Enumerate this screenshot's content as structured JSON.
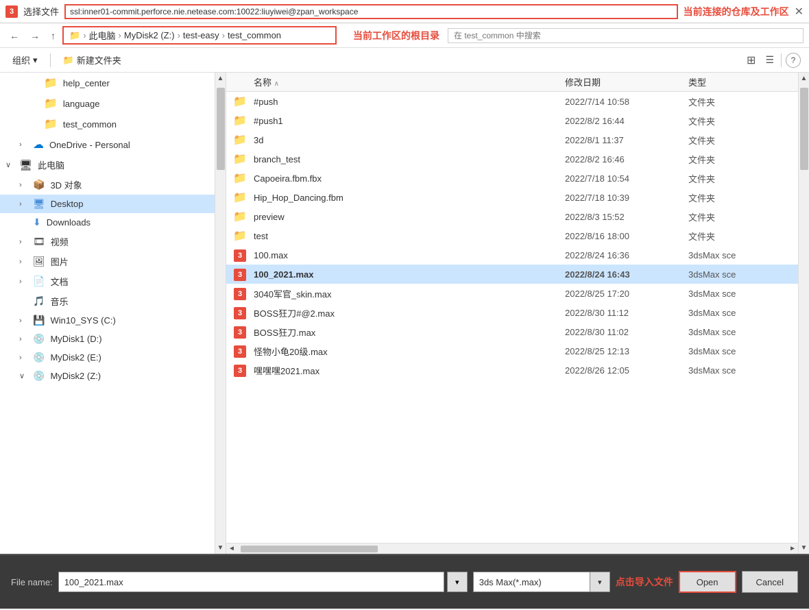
{
  "titlebar": {
    "label": "选择文件",
    "path": "ssl:inner01-commit.perforce.nie.netease.com:10022:liuyiwei@zpan_workspace",
    "annotation": "当前连接的仓库及工作区"
  },
  "navbar": {
    "back": "←",
    "forward": "→",
    "up": "↑",
    "breadcrumb": [
      "此电脑",
      "MyDisk2 (Z:)",
      "test-easy",
      "test_common"
    ],
    "breadcrumb_icon": "📁",
    "annotation": "当前工作区的根目录",
    "search_placeholder": "在 test_common 中搜索"
  },
  "toolbar": {
    "organize": "组织",
    "new_folder": "新建文件夹",
    "view_icons": "⊞",
    "view_list": "☰",
    "help": "?"
  },
  "sidebar": {
    "items": [
      {
        "id": "help_center",
        "label": "help_center",
        "indent": 2,
        "icon": "folder",
        "expand": ""
      },
      {
        "id": "language",
        "label": "language",
        "indent": 2,
        "icon": "folder",
        "expand": ""
      },
      {
        "id": "test_common",
        "label": "test_common",
        "indent": 2,
        "icon": "folder",
        "expand": ""
      },
      {
        "id": "onedrive",
        "label": "OneDrive - Personal",
        "indent": 1,
        "icon": "onedrive",
        "expand": ">"
      },
      {
        "id": "computer",
        "label": "此电脑",
        "indent": 0,
        "icon": "computer",
        "expand": "∨"
      },
      {
        "id": "3d",
        "label": "3D 对象",
        "indent": 1,
        "icon": "folder3d",
        "expand": ">"
      },
      {
        "id": "desktop",
        "label": "Desktop",
        "indent": 1,
        "icon": "desktop",
        "expand": ">"
      },
      {
        "id": "downloads",
        "label": "Downloads",
        "indent": 1,
        "icon": "download",
        "expand": ""
      },
      {
        "id": "videos",
        "label": "视频",
        "indent": 1,
        "icon": "video",
        "expand": ">"
      },
      {
        "id": "pictures",
        "label": "图片",
        "indent": 1,
        "icon": "picture",
        "expand": ">"
      },
      {
        "id": "documents",
        "label": "文档",
        "indent": 1,
        "icon": "document",
        "expand": ">"
      },
      {
        "id": "music",
        "label": "音乐",
        "indent": 1,
        "icon": "music",
        "expand": ""
      },
      {
        "id": "win10sys",
        "label": "Win10_SYS (C:)",
        "indent": 1,
        "icon": "disk",
        "expand": ">"
      },
      {
        "id": "mydisk1",
        "label": "MyDisk1 (D:)",
        "indent": 1,
        "icon": "disk",
        "expand": ">"
      },
      {
        "id": "mydisk2e",
        "label": "MyDisk2 (E:)",
        "indent": 1,
        "icon": "disk",
        "expand": ">"
      },
      {
        "id": "mydisk2z",
        "label": "MyDisk2 (Z:)",
        "indent": 1,
        "icon": "disk",
        "expand": "∨"
      }
    ]
  },
  "filelist": {
    "headers": {
      "name": "名称",
      "date": "修改日期",
      "type": "类型"
    },
    "rows": [
      {
        "id": "push",
        "name": "#push",
        "date": "2022/7/14 10:58",
        "type": "文件夹",
        "icon": "folder",
        "selected": false
      },
      {
        "id": "push1",
        "name": "#push1",
        "date": "2022/8/2 16:44",
        "type": "文件夹",
        "icon": "folder",
        "selected": false
      },
      {
        "id": "3d",
        "name": "3d",
        "date": "2022/8/1 11:37",
        "type": "文件夹",
        "icon": "folder",
        "selected": false
      },
      {
        "id": "branch_test",
        "name": "branch_test",
        "date": "2022/8/2 16:46",
        "type": "文件夹",
        "icon": "folder",
        "selected": false
      },
      {
        "id": "capoeira",
        "name": "Capoeira.fbm.fbx",
        "date": "2022/7/18 10:54",
        "type": "文件夹",
        "icon": "folder",
        "selected": false
      },
      {
        "id": "hiphop",
        "name": "Hip_Hop_Dancing.fbm",
        "date": "2022/7/18 10:39",
        "type": "文件夹",
        "icon": "folder",
        "selected": false
      },
      {
        "id": "preview",
        "name": "preview",
        "date": "2022/8/3 15:52",
        "type": "文件夹",
        "icon": "folder",
        "selected": false
      },
      {
        "id": "test",
        "name": "test",
        "date": "2022/8/16 18:00",
        "type": "文件夹",
        "icon": "folder",
        "selected": false
      },
      {
        "id": "100max",
        "name": "100.max",
        "date": "2022/8/24 16:36",
        "type": "3dsMax sce",
        "icon": "3ds",
        "selected": false
      },
      {
        "id": "100_2021max",
        "name": "100_2021.max",
        "date": "2022/8/24 16:43",
        "type": "3dsMax sce",
        "icon": "3ds",
        "selected": true
      },
      {
        "id": "3040",
        "name": "3040军官_skin.max",
        "date": "2022/8/25 17:20",
        "type": "3dsMax sce",
        "icon": "3ds",
        "selected": false
      },
      {
        "id": "boss_knife2",
        "name": "BOSS狂刀#@2.max",
        "date": "2022/8/30 11:12",
        "type": "3dsMax sce",
        "icon": "3ds",
        "selected": false
      },
      {
        "id": "boss_knife",
        "name": "BOSS狂刀.max",
        "date": "2022/8/30 11:02",
        "type": "3dsMax sce",
        "icon": "3ds",
        "selected": false
      },
      {
        "id": "turtle",
        "name": "怪物小龟20级.max",
        "date": "2022/8/25 12:13",
        "type": "3dsMax sce",
        "icon": "3ds",
        "selected": false
      },
      {
        "id": "nene",
        "name": "嘿嘿嘿2021.max",
        "date": "2022/8/26 12:05",
        "type": "3dsMax sce",
        "icon": "3ds",
        "selected": false
      }
    ]
  },
  "bottombar": {
    "filename_label": "File name:",
    "filename_value": "100_2021.max",
    "filetype_value": "3ds Max(*.max)",
    "open_label": "Open",
    "cancel_label": "Cancel",
    "annotation": "点击导入文件"
  }
}
